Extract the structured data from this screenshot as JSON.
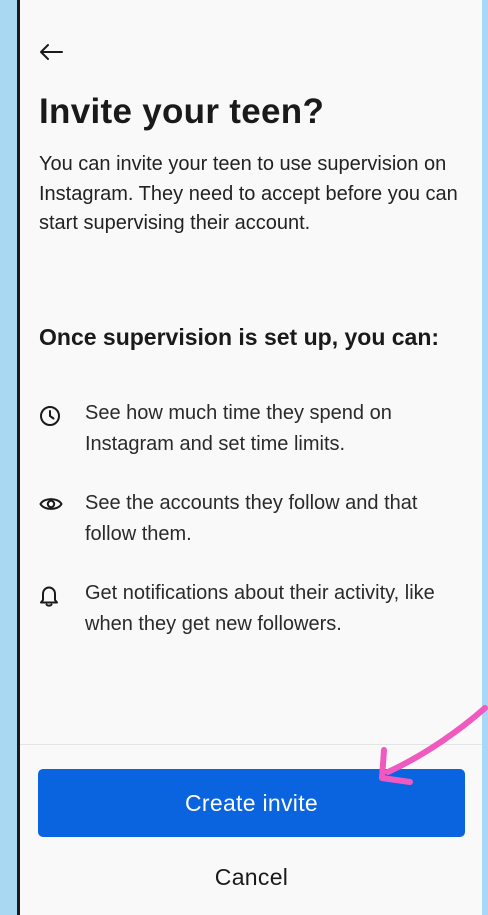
{
  "header": {
    "back_icon": "arrow-left-icon"
  },
  "main": {
    "title": "Invite your teen?",
    "intro": "You can invite your teen to use supervision on Instagram. They need to accept before you can start supervising their account.",
    "subheading": "Once supervision is set up, you can:",
    "features": [
      {
        "icon": "clock-icon",
        "text": "See how much time they spend on Instagram and set time limits."
      },
      {
        "icon": "eye-icon",
        "text": "See the accounts they follow and that follow them."
      },
      {
        "icon": "bell-icon",
        "text": "Get notifications about their activity, like when they get new followers."
      }
    ]
  },
  "footer": {
    "primary_label": "Create invite",
    "cancel_label": "Cancel"
  },
  "colors": {
    "background": "#a8d8f2",
    "accent_blue": "#0a64e0",
    "annotation_pink": "#f05ac0"
  }
}
